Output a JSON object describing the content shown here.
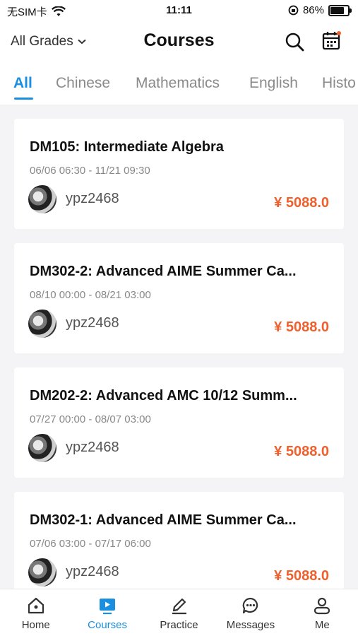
{
  "status_bar": {
    "carrier": "无SIM卡",
    "time": "11:11",
    "battery_percent": "86%",
    "battery_level": 0.86
  },
  "header": {
    "grade_filter": "All Grades",
    "title": "Courses"
  },
  "tabs": [
    {
      "label": "All",
      "active": true
    },
    {
      "label": "Chinese",
      "active": false
    },
    {
      "label": "Mathematics",
      "active": false
    },
    {
      "label": "English",
      "active": false
    },
    {
      "label": "Histo",
      "active": false
    }
  ],
  "courses": [
    {
      "title": "DM105: Intermediate Algebra",
      "dates": "06/06 06:30 - 11/21 09:30",
      "author": "ypz2468",
      "price": "¥ 5088.0"
    },
    {
      "title": "DM302-2: Advanced AIME Summer Ca...",
      "dates": "08/10 00:00 - 08/21 03:00",
      "author": "ypz2468",
      "price": "¥ 5088.0"
    },
    {
      "title": "DM202-2: Advanced AMC 10/12 Summ...",
      "dates": "07/27 00:00 - 08/07 03:00",
      "author": "ypz2468",
      "price": "¥ 5088.0"
    },
    {
      "title": "DM302-1: Advanced AIME Summer Ca...",
      "dates": "07/06 03:00 - 07/17 06:00",
      "author": "ypz2468",
      "price": "¥ 5088.0"
    }
  ],
  "bottom_nav": [
    {
      "label": "Home",
      "icon": "home-icon"
    },
    {
      "label": "Courses",
      "icon": "play-icon"
    },
    {
      "label": "Practice",
      "icon": "pencil-icon"
    },
    {
      "label": "Messages",
      "icon": "chat-icon"
    },
    {
      "label": "Me",
      "icon": "user-icon"
    }
  ],
  "colors": {
    "accent": "#1a8fe0",
    "price": "#f0602d",
    "background": "#f4f4f6"
  }
}
